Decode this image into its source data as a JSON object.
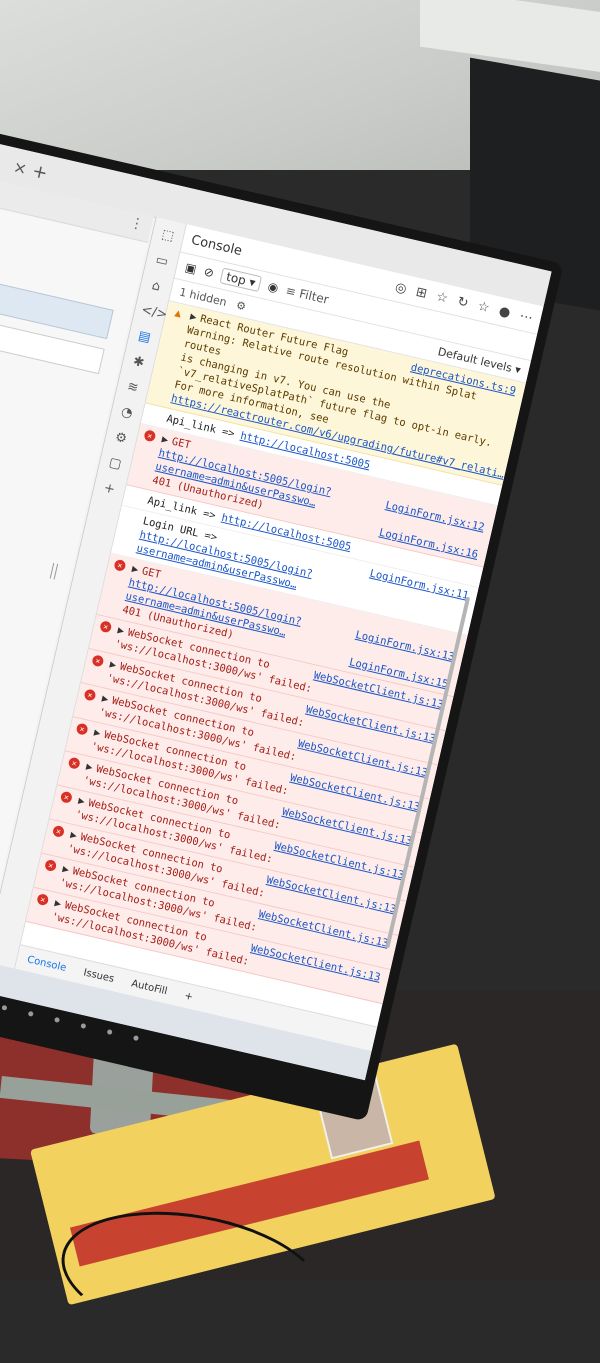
{
  "browser": {
    "tab_close_glyph": "×",
    "tab_add_glyph": "+"
  },
  "devtools": {
    "panel_title": "Console",
    "context": "top",
    "hidden_count": "1 hidden",
    "filter_placeholder": "Filter",
    "levels_label": "Default levels",
    "bottom_tabs": [
      "Console",
      "Issues",
      "AutoFill"
    ],
    "bottom_add": "+"
  },
  "console": {
    "warning": {
      "title": "React Router Future Flag",
      "source": "deprecations.ts:9",
      "line1": "Warning: Relative route resolution within Splat routes",
      "line2": "is changing in v7. You can use the",
      "line3": "`v7_relativeSplatPath` future flag to opt-in early.",
      "line4": "For more information, see",
      "link": "https://reactrouter.com/v6/upgrading/future#v7_relati…"
    },
    "log1": {
      "text": "Api_link =>",
      "link": "http://localhost:5005"
    },
    "get1": {
      "method": "GET",
      "url": "http://localhost:5005/login?username=admin&userPasswo…",
      "source": "LoginForm.jsx:12",
      "status": "401 (Unauthorized)",
      "source2": "LoginForm.jsx:16"
    },
    "log2": {
      "text": "Api_link =>",
      "link": "http://localhost:5005"
    },
    "log3": {
      "text": "Login URL =>",
      "link": "http://localhost:5005/login?username=admin&userPasswo…",
      "source": "LoginForm.jsx:11"
    },
    "get2": {
      "method": "GET",
      "url": "http://localhost:5005/login?username=admin&userPasswo…",
      "source": "LoginForm.jsx:13",
      "status": "401 (Unauthorized)",
      "source2": "LoginForm.jsx:15"
    },
    "ws": [
      {
        "text": "WebSocket connection to",
        "url": "'ws://localhost:3000/ws' failed:",
        "source": "WebSocketClient.js:13"
      },
      {
        "text": "WebSocket connection to",
        "url": "'ws://localhost:3000/ws' failed:",
        "source": "WebSocketClient.js:13"
      },
      {
        "text": "WebSocket connection to",
        "url": "'ws://localhost:3000/ws' failed:",
        "source": "WebSocketClient.js:13"
      },
      {
        "text": "WebSocket connection to",
        "url": "'ws://localhost:3000/ws' failed:",
        "source": "WebSocketClient.js:13"
      },
      {
        "text": "WebSocket connection to",
        "url": "'ws://localhost:3000/ws' failed:",
        "source": "WebSocketClient.js:13"
      },
      {
        "text": "WebSocket connection to",
        "url": "'ws://localhost:3000/ws' failed:",
        "source": "WebSocketClient.js:13"
      },
      {
        "text": "WebSocket connection to",
        "url": "'ws://localhost:3000/ws' failed:",
        "source": "WebSocketClient.js:13"
      },
      {
        "text": "WebSocket connection to",
        "url": "'ws://localhost:3000/ws' failed:",
        "source": "WebSocketClient.js:13"
      },
      {
        "text": "WebSocket connection to",
        "url": "'ws://localhost:3000/ws' failed:",
        "source": "WebSocketClient.js:13"
      }
    ]
  },
  "colors": {
    "warning_bg": "#fdf6d8",
    "error_bg": "#fdecea",
    "error_badge": "#d93025",
    "link": "#1a55c7",
    "monitor_bezel": "#151515"
  }
}
